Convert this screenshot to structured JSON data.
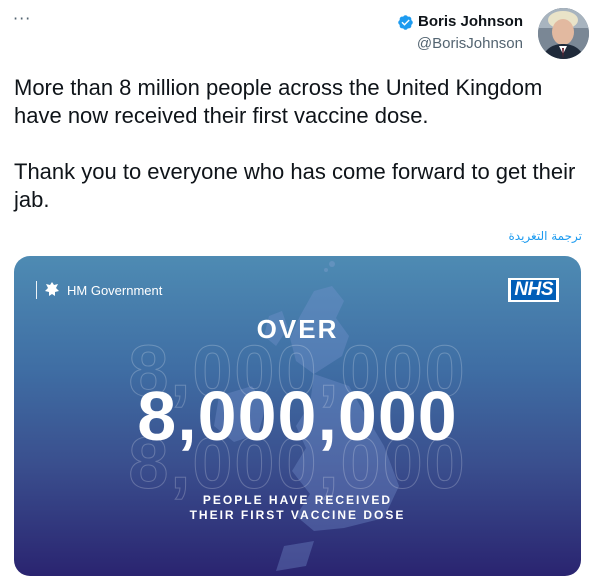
{
  "tweet": {
    "more_label": "···",
    "author": {
      "display_name": "Boris Johnson",
      "handle": "@BorisJohnson",
      "verified": true
    },
    "text": "More than 8 million people across the United Kingdom have now received their first vaccine dose.\n\nThank you to everyone who has come forward to get their jab.",
    "translate_label": "ترجمة التغريدة"
  },
  "media": {
    "gov_label": "HM Government",
    "nhs_label": "NHS",
    "over_label": "OVER",
    "figure": "8,000,000",
    "caption_line1": "PEOPLE HAVE RECEIVED",
    "caption_line2": "THEIR FIRST VACCINE DOSE"
  },
  "colors": {
    "accent": "#1d9bf0",
    "nhs_blue": "#005eb8",
    "card_top": "#4e8bb3",
    "card_bottom": "#2a2470"
  },
  "icons": {
    "more": "more-icon",
    "verified": "verified-badge-icon",
    "crest": "crest-icon"
  }
}
